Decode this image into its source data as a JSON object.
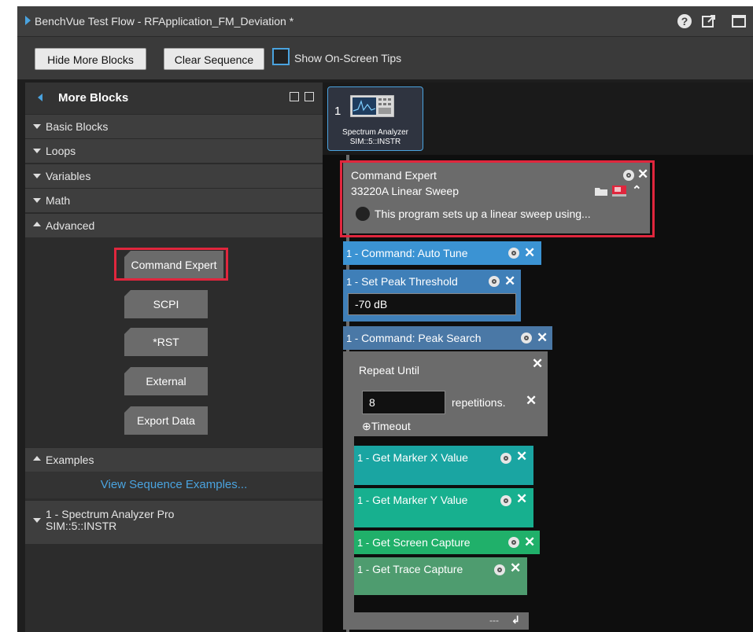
{
  "window": {
    "title": "BenchVue Test Flow - RFApplication_FM_Deviation *"
  },
  "toolbar": {
    "hide_more_blocks": "Hide More Blocks",
    "clear_sequence": "Clear Sequence",
    "show_tips": "Show On-Screen Tips"
  },
  "left_panel": {
    "title": "More Blocks",
    "categories": [
      {
        "label": "Basic Blocks",
        "expanded": false
      },
      {
        "label": "Loops",
        "expanded": false
      },
      {
        "label": "Variables",
        "expanded": false
      },
      {
        "label": "Math",
        "expanded": false
      },
      {
        "label": "Advanced",
        "expanded": true
      }
    ],
    "advanced_blocks": [
      "Command Expert",
      "SCPI",
      "*RST",
      "External",
      "Export Data"
    ],
    "examples": {
      "label": "Examples",
      "link": "View Sequence Examples..."
    },
    "instrument": {
      "line1": "1 - Spectrum Analyzer Pro",
      "line2": "SIM::5::INSTR"
    }
  },
  "device": {
    "number": "1",
    "name": "Spectrum Analyzer",
    "address": "SIM::5::INSTR"
  },
  "sequence": {
    "command_expert": {
      "title": "Command Expert",
      "subtitle": "33220A Linear Sweep",
      "description": "This program sets up a linear sweep using..."
    },
    "auto_tune": {
      "num": "1 -",
      "label": "Command: Auto Tune"
    },
    "peak_threshold": {
      "num": "1 -",
      "label": "Set Peak Threshold",
      "value": "-70 dB"
    },
    "peak_search": {
      "num": "1 -",
      "label": "Command: Peak Search"
    },
    "repeat": {
      "title": "Repeat Until",
      "count": "8",
      "unit": "repetitions.",
      "timeout": "⊕Timeout",
      "footer": "---"
    },
    "marker_x": {
      "num": "1 -",
      "label": "Get Marker X Value"
    },
    "marker_y": {
      "num": "1 -",
      "label": "Get Marker Y Value"
    },
    "screen_capture": {
      "num": "1 -",
      "label": "Get Screen Capture"
    },
    "trace_capture": {
      "num": "1 -",
      "label": "Get Trace Capture"
    }
  },
  "colors": {
    "accent": "#4aa3df",
    "highlight": "#e0263d",
    "teal": "#1aa5a2",
    "green": "#34b27a"
  }
}
